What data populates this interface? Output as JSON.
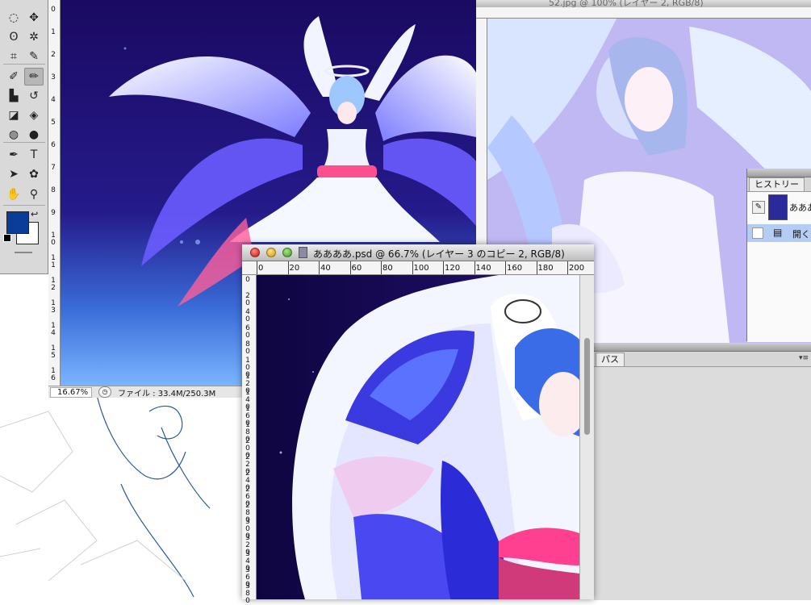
{
  "tools": {
    "items": [
      {
        "name": "marquee-tool",
        "glyph": "◌"
      },
      {
        "name": "move-tool",
        "glyph": "✥"
      },
      {
        "name": "lasso-tool",
        "glyph": "ʘ"
      },
      {
        "name": "magic-wand-tool",
        "glyph": "✲"
      },
      {
        "name": "crop-tool",
        "glyph": "⌗"
      },
      {
        "name": "eyedropper-tool",
        "glyph": "✎"
      },
      {
        "name": "spot-healing-tool",
        "glyph": "✐"
      },
      {
        "name": "brush-tool",
        "glyph": "✏"
      },
      {
        "name": "clone-stamp-tool",
        "glyph": "▙"
      },
      {
        "name": "history-brush-tool",
        "glyph": "↺"
      },
      {
        "name": "eraser-tool",
        "glyph": "◪"
      },
      {
        "name": "paint-bucket-tool",
        "glyph": "◈"
      },
      {
        "name": "blur-tool",
        "glyph": "◍"
      },
      {
        "name": "dodge-tool",
        "glyph": "●"
      },
      {
        "name": "pen-tool",
        "glyph": "✒"
      },
      {
        "name": "type-tool",
        "glyph": "T"
      },
      {
        "name": "path-selection-tool",
        "glyph": "➤"
      },
      {
        "name": "custom-shape-tool",
        "glyph": "✿"
      },
      {
        "name": "hand-tool",
        "glyph": "✋"
      },
      {
        "name": "zoom-tool",
        "glyph": "⚲"
      }
    ],
    "selected": "brush-tool",
    "foreground_color": "#0a3c9a",
    "background_color": "#ffffff"
  },
  "window1": {
    "zoom": "16.67%",
    "file_info": "ファイル : 33.4M/250.3M",
    "ruler_ticks": [
      "0",
      "1",
      "2",
      "3",
      "4",
      "5",
      "6",
      "7",
      "8",
      "9",
      "1 0",
      "1 1",
      "1 2",
      "1 3",
      "1 4",
      "1 5",
      "1 6"
    ]
  },
  "window2": {
    "title": "52.jpg @ 100% (レイヤー 2, RGB/8)"
  },
  "history_panel": {
    "tab": "ヒストリー",
    "snapshot_label": "ああああ",
    "step_label": "開く"
  },
  "paths_panel": {
    "tab": "パス",
    "menu_icon": "▾≡"
  },
  "window3": {
    "title": "ああああ.psd @ 66.7% (レイヤー 3 のコピー 2, RGB/8)",
    "h_ruler": [
      "0",
      "20",
      "40",
      "60",
      "80",
      "100",
      "120",
      "140",
      "160",
      "180",
      "200"
    ],
    "v_ruler": [
      "0",
      "2 0",
      "4 0",
      "6 0",
      "8 0",
      "1 0 0",
      "1 2 0",
      "1 4 0",
      "1 6 0",
      "1 8 0",
      "2 0 0",
      "2 2 0",
      "2 4 0",
      "2 6 0",
      "2 8 0",
      "3 0 0",
      "3 2 0",
      "3 4 0",
      "3 6 0",
      "3 8 0"
    ]
  },
  "colors": {
    "canvas_dark": "#16085c",
    "wing_blue": "#5a5aff",
    "wing_pale": "#e6ecff",
    "skirt_pink": "#ff4f8f"
  }
}
